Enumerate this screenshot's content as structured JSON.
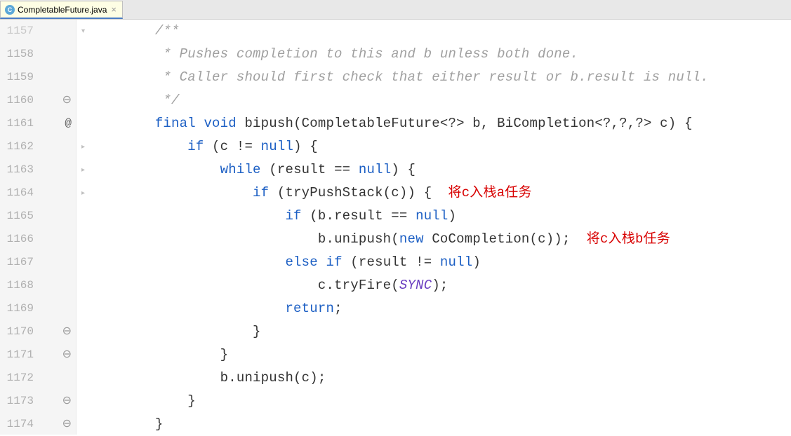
{
  "tab": {
    "icon_letter": "C",
    "filename": "CompletableFuture.java",
    "close": "×"
  },
  "lines": {
    "1157": {
      "num": "1157",
      "mark": "",
      "fold": "▾",
      "indent": "        ",
      "tokens": [
        {
          "cls": "comment",
          "t": "/**"
        }
      ]
    },
    "1158": {
      "num": "1158",
      "mark": "",
      "fold": "",
      "indent": "         ",
      "tokens": [
        {
          "cls": "comment",
          "t": "* Pushes completion to this and b unless both done."
        }
      ]
    },
    "1159": {
      "num": "1159",
      "mark": "",
      "fold": "",
      "indent": "         ",
      "tokens": [
        {
          "cls": "comment",
          "t": "* Caller should first check that either result or b.result is null."
        }
      ]
    },
    "1160": {
      "num": "1160",
      "mark": "⊖",
      "fold": "",
      "indent": "         ",
      "tokens": [
        {
          "cls": "comment",
          "t": "*/"
        }
      ]
    },
    "1161": {
      "num": "1161",
      "mark": "@",
      "fold": "",
      "indent": "        ",
      "tokens": [
        {
          "cls": "kw",
          "t": "final void "
        },
        {
          "cls": "txt",
          "t": "bipush(CompletableFuture<?> b, BiCompletion<?,?,?> c) {"
        }
      ]
    },
    "1162": {
      "num": "1162",
      "mark": "",
      "fold": "▸",
      "indent": "            ",
      "tokens": [
        {
          "cls": "kw",
          "t": "if "
        },
        {
          "cls": "txt",
          "t": "(c != "
        },
        {
          "cls": "kw",
          "t": "null"
        },
        {
          "cls": "txt",
          "t": ") {"
        }
      ]
    },
    "1163": {
      "num": "1163",
      "mark": "",
      "fold": "▸",
      "indent": "                ",
      "tokens": [
        {
          "cls": "kw",
          "t": "while "
        },
        {
          "cls": "txt",
          "t": "(result == "
        },
        {
          "cls": "kw",
          "t": "null"
        },
        {
          "cls": "txt",
          "t": ") {"
        }
      ]
    },
    "1164": {
      "num": "1164",
      "mark": "",
      "fold": "▸",
      "indent": "                    ",
      "tokens": [
        {
          "cls": "kw",
          "t": "if "
        },
        {
          "cls": "txt",
          "t": "(tryPushStack(c)) {  "
        },
        {
          "cls": "str-red",
          "t": "将c入栈a任务"
        }
      ]
    },
    "1165": {
      "num": "1165",
      "mark": "",
      "fold": "",
      "indent": "                        ",
      "tokens": [
        {
          "cls": "kw",
          "t": "if "
        },
        {
          "cls": "txt",
          "t": "(b.result == "
        },
        {
          "cls": "kw",
          "t": "null"
        },
        {
          "cls": "txt",
          "t": ")"
        }
      ]
    },
    "1166": {
      "num": "1166",
      "mark": "",
      "fold": "",
      "indent": "                            ",
      "tokens": [
        {
          "cls": "txt",
          "t": "b.unipush("
        },
        {
          "cls": "kw",
          "t": "new "
        },
        {
          "cls": "txt",
          "t": "CoCompletion(c));  "
        },
        {
          "cls": "str-red",
          "t": "将c入栈b任务"
        }
      ]
    },
    "1167": {
      "num": "1167",
      "mark": "",
      "fold": "",
      "indent": "                        ",
      "tokens": [
        {
          "cls": "kw",
          "t": "else if "
        },
        {
          "cls": "txt",
          "t": "(result != "
        },
        {
          "cls": "kw",
          "t": "null"
        },
        {
          "cls": "txt",
          "t": ")"
        }
      ]
    },
    "1168": {
      "num": "1168",
      "mark": "",
      "fold": "",
      "indent": "                            ",
      "tokens": [
        {
          "cls": "txt",
          "t": "c.tryFire("
        },
        {
          "cls": "italic-purple",
          "t": "SYNC"
        },
        {
          "cls": "txt",
          "t": ");"
        }
      ]
    },
    "1169": {
      "num": "1169",
      "mark": "",
      "fold": "",
      "indent": "                        ",
      "tokens": [
        {
          "cls": "kw",
          "t": "return"
        },
        {
          "cls": "txt",
          "t": ";"
        }
      ]
    },
    "1170": {
      "num": "1170",
      "mark": "⊖",
      "fold": "",
      "indent": "                    ",
      "tokens": [
        {
          "cls": "txt",
          "t": "}"
        }
      ]
    },
    "1171": {
      "num": "1171",
      "mark": "⊖",
      "fold": "",
      "indent": "                ",
      "tokens": [
        {
          "cls": "txt",
          "t": "}"
        }
      ]
    },
    "1172": {
      "num": "1172",
      "mark": "",
      "fold": "",
      "indent": "                ",
      "tokens": [
        {
          "cls": "txt",
          "t": "b.unipush(c);"
        }
      ]
    },
    "1173": {
      "num": "1173",
      "mark": "⊖",
      "fold": "",
      "indent": "            ",
      "tokens": [
        {
          "cls": "txt",
          "t": "}"
        }
      ]
    },
    "1174": {
      "num": "1174",
      "mark": "⊖",
      "fold": "",
      "indent": "        ",
      "tokens": [
        {
          "cls": "txt",
          "t": "}"
        }
      ]
    }
  },
  "order": [
    "1157",
    "1158",
    "1159",
    "1160",
    "1161",
    "1162",
    "1163",
    "1164",
    "1165",
    "1166",
    "1167",
    "1168",
    "1169",
    "1170",
    "1171",
    "1172",
    "1173",
    "1174"
  ]
}
